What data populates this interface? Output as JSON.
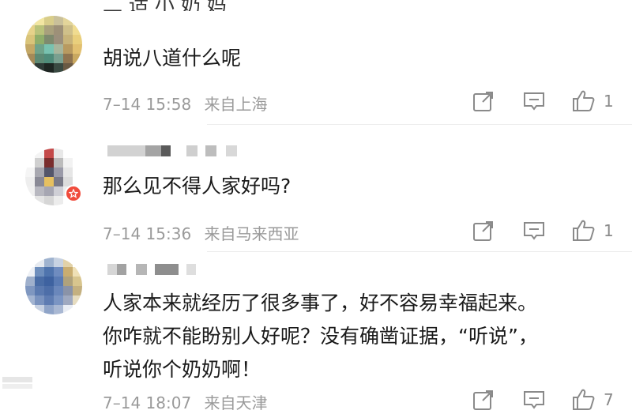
{
  "comments": [
    {
      "username_partial": "二 适 小 奶 妈",
      "text": "胡说八道什么呢",
      "time": "7–14 15:58",
      "location": "来自上海",
      "likes": "1",
      "share_icon": "share-icon",
      "reply_icon": "comment-icon",
      "like_icon": "thumbs-up-icon"
    },
    {
      "text": "那么见不得人家好吗?",
      "time": "7–14 15:36",
      "location": "来自马来西亚",
      "likes": "1",
      "share_icon": "share-icon",
      "reply_icon": "comment-icon",
      "like_icon": "thumbs-up-icon"
    },
    {
      "text_lines": [
        "人家本来就经历了很多事了，好不容易幸福起来。",
        "你咋就不能盼别人好呢？没有确凿证据，“听说”，",
        "听说你个奶奶啊！"
      ],
      "time": "7–14 18:07",
      "location": "来自天津",
      "likes": "7",
      "share_icon": "share-icon",
      "reply_icon": "comment-icon",
      "like_icon": "thumbs-up-icon"
    }
  ],
  "colors": {
    "text": "#1a1a1a",
    "meta": "#9a9a9a",
    "icon": "#8a8a8a",
    "badge": "#f04b3c"
  }
}
